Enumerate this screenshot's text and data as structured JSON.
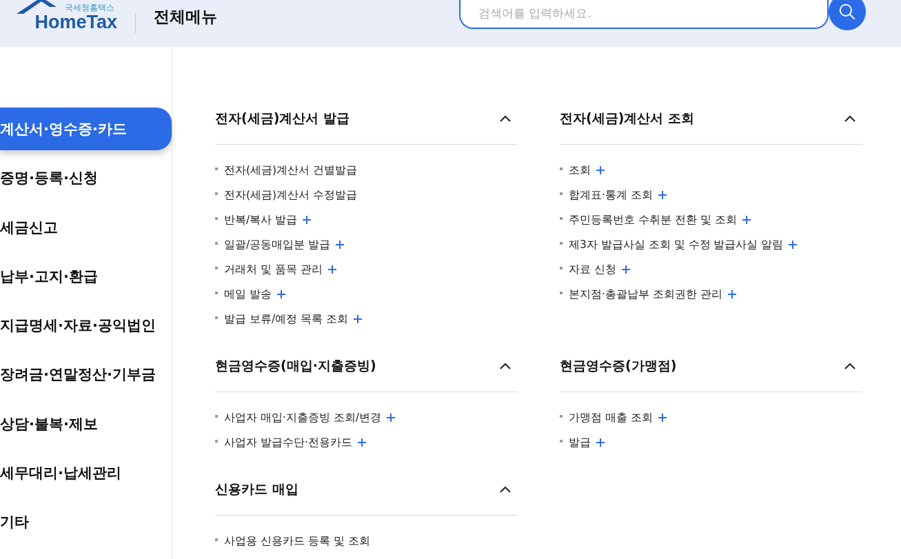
{
  "header": {
    "logo": {
      "subtitle": "국세청홈택스",
      "name": "HomeTax"
    },
    "title": "전체메뉴",
    "search": {
      "placeholder": "검색어를 입력하세요."
    }
  },
  "sidebar": {
    "items": [
      {
        "label": "계산서·영수증·카드",
        "selected": true
      },
      {
        "label": "증명·등록·신청",
        "selected": false
      },
      {
        "label": "세금신고",
        "selected": false
      },
      {
        "label": "납부·고지·환급",
        "selected": false
      },
      {
        "label": "지급명세·자료·공익법인",
        "selected": false
      },
      {
        "label": "장려금·연말정산·기부금",
        "selected": false
      },
      {
        "label": "상담·불복·제보",
        "selected": false
      },
      {
        "label": "세무대리·납세관리",
        "selected": false
      },
      {
        "label": "기타",
        "selected": false
      }
    ]
  },
  "sections": [
    {
      "title": "전자(세금)계산서 발급",
      "expanded": true,
      "items": [
        {
          "label": "전자(세금)계산서 건별발급",
          "has_submenu": false
        },
        {
          "label": "전자(세금)계산서 수정발급",
          "has_submenu": false
        },
        {
          "label": "반복/복사 발급",
          "has_submenu": true
        },
        {
          "label": "일괄/공동매입분 발급",
          "has_submenu": true
        },
        {
          "label": "거래처 및 품목 관리",
          "has_submenu": true
        },
        {
          "label": "메일 발송",
          "has_submenu": true
        },
        {
          "label": "발급 보류/예정 목록 조회",
          "has_submenu": true
        }
      ]
    },
    {
      "title": "전자(세금)계산서 조회",
      "expanded": true,
      "items": [
        {
          "label": "조회",
          "has_submenu": true
        },
        {
          "label": "합계표·통계 조회",
          "has_submenu": true
        },
        {
          "label": "주민등록번호 수취분 전환 및 조회",
          "has_submenu": true
        },
        {
          "label": "제3자 발급사실 조회 및 수정 발급사실 알림",
          "has_submenu": true
        },
        {
          "label": "자료 신청",
          "has_submenu": true
        },
        {
          "label": "본지점·총괄납부 조회권한 관리",
          "has_submenu": true
        }
      ]
    },
    {
      "title": "현금영수증(매입·지출증빙)",
      "expanded": true,
      "items": [
        {
          "label": "사업자 매입·지출증빙 조회/변경",
          "has_submenu": true
        },
        {
          "label": "사업자 발급수단·전용카드",
          "has_submenu": true
        }
      ]
    },
    {
      "title": "현금영수증(가맹점)",
      "expanded": true,
      "items": [
        {
          "label": "가맹점 매출 조회",
          "has_submenu": true
        },
        {
          "label": "발급",
          "has_submenu": true
        }
      ]
    },
    {
      "title": "신용카드 매입",
      "expanded": true,
      "items": [
        {
          "label": "사업용 신용카드 등록 및 조회",
          "has_submenu": false
        }
      ]
    }
  ]
}
